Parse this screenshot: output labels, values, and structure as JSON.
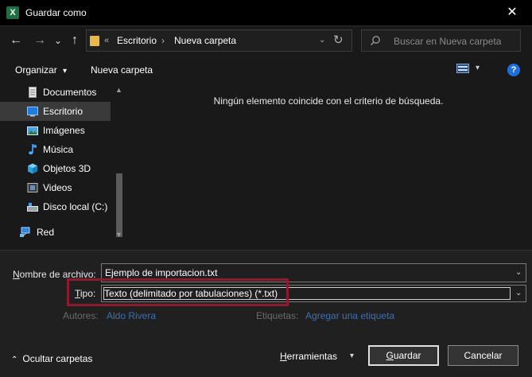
{
  "window": {
    "title": "Guardar como",
    "app_icon_letter": "X",
    "close_glyph": "✕"
  },
  "nav": {
    "back_glyph": "←",
    "forward_glyph": "→",
    "recent_glyph": "⌄",
    "up_glyph": "↑",
    "address": {
      "prefix": "«",
      "crumbs": [
        "Escritorio",
        "Nueva carpeta"
      ],
      "separator": "›",
      "dropdown_glyph": "⌄",
      "refresh_glyph": "↻"
    },
    "search_placeholder": "Buscar en Nueva carpeta"
  },
  "commands": {
    "organize_label": "Organizar",
    "organize_glyph": "▾",
    "new_folder_label": "Nueva carpeta",
    "view_dropdown_glyph": "▾",
    "help_glyph": "?"
  },
  "sidebar": {
    "items": [
      {
        "label": "Documentos",
        "icon": "documents-icon",
        "selected": false
      },
      {
        "label": "Escritorio",
        "icon": "desktop-icon",
        "selected": true
      },
      {
        "label": "Imágenes",
        "icon": "pictures-icon",
        "selected": false
      },
      {
        "label": "Música",
        "icon": "music-icon",
        "selected": false
      },
      {
        "label": "Objetos 3D",
        "icon": "3d-objects-icon",
        "selected": false
      },
      {
        "label": "Videos",
        "icon": "videos-icon",
        "selected": false
      },
      {
        "label": "Disco local (C:)",
        "icon": "local-disk-icon",
        "selected": false
      },
      {
        "label": "Red",
        "icon": "network-icon",
        "selected": false
      }
    ],
    "scroll_up_glyph": "▲",
    "scroll_down_glyph": "▼"
  },
  "content": {
    "empty_message": "Ningún elemento coincide con el criterio de búsqueda."
  },
  "form": {
    "filename": {
      "label_first": "N",
      "label_rest": "ombre de archivo:",
      "value": "Ejemplo de importacion.txt",
      "dropdown_glyph": "⌄"
    },
    "type": {
      "label_first": "T",
      "label_rest": "ipo:",
      "value": "Texto (delimitado por tabulaciones) (*.txt)",
      "dropdown_glyph": "⌄"
    },
    "authors": {
      "label": "Autores:",
      "value": "Aldo Rivera"
    },
    "tags": {
      "label": "Etiquetas:",
      "value": "Agregar una etiqueta"
    }
  },
  "footer": {
    "hide_folders_glyph": "⌃",
    "hide_folders_label": "Ocultar carpetas",
    "tools_first": "H",
    "tools_rest": "erramientas",
    "tools_glyph": "▾",
    "save_first": "G",
    "save_rest": "uardar",
    "cancel_label": "Cancelar"
  },
  "colors": {
    "accent_blue": "#1e6fd9",
    "highlight_red": "#8e1b2d",
    "folder_yellow": "#e8b94a",
    "excel_green": "#1d6f42"
  }
}
